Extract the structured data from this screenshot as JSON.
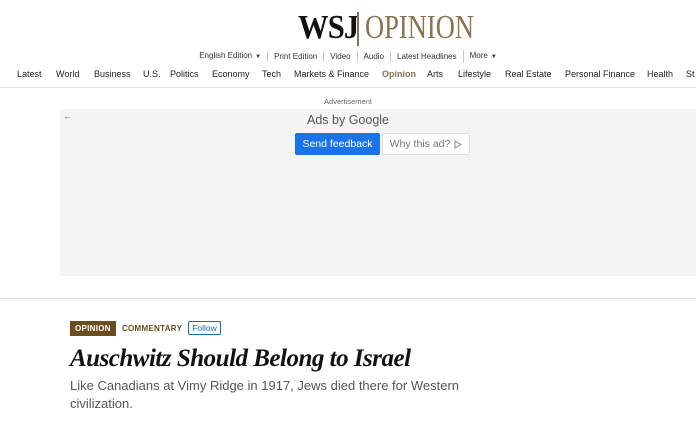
{
  "masthead": {
    "logo_left": "WSJ",
    "logo_right": "OPINION"
  },
  "utility": {
    "edition": "English Edition",
    "links": [
      "Print Edition",
      "Video",
      "Audio",
      "Latest Headlines"
    ],
    "more": "More"
  },
  "nav": {
    "items": [
      "Latest",
      "World",
      "Business",
      "U.S.",
      "Politics",
      "Economy",
      "Tech",
      "Markets & Finance",
      "Opinion",
      "Arts",
      "Lifestyle",
      "Real Estate",
      "Personal Finance",
      "Health",
      "St"
    ],
    "active": "Opinion"
  },
  "ad": {
    "label": "Advertisement",
    "ads_by": "Ads by",
    "brand": "Google",
    "feedback": "Send feedback",
    "why": "Why this ad?"
  },
  "article": {
    "tag": "OPINION",
    "category": "COMMENTARY",
    "follow": "Follow",
    "headline": "Auschwitz Should Belong to Israel",
    "dek": "Like Canadians at Vimy Ridge in 1917, Jews died there for Western civilization."
  },
  "colors": {
    "brand_gold": "#8a7350",
    "tag_brown": "#6b4e1f",
    "google_blue": "#1a73e8"
  }
}
